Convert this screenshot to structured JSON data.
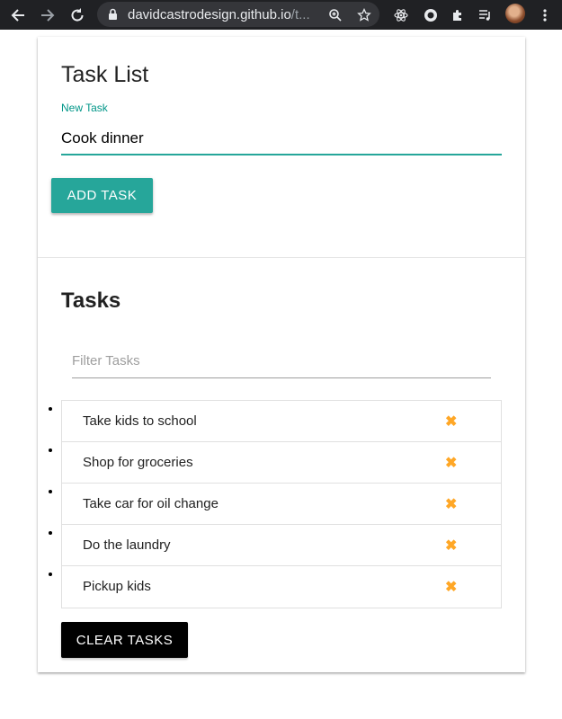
{
  "browser": {
    "url_host": "davidcastrodesign.github.io",
    "url_rest": "/t...",
    "icons": [
      "back-icon",
      "forward-icon",
      "reload-icon",
      "lock-icon",
      "zoom-icon",
      "star-icon",
      "react-devtools-icon",
      "extension-circle-icon",
      "puzzle-icon",
      "media-queue-icon",
      "avatar",
      "menu-icon"
    ]
  },
  "form": {
    "title": "Task List",
    "field_label": "New Task",
    "task_value": "Cook dinner",
    "add_label": "Add Task"
  },
  "tasks": {
    "title": "Tasks",
    "filter_placeholder": "Filter Tasks",
    "items": [
      {
        "text": "Take kids to school"
      },
      {
        "text": "Shop for groceries"
      },
      {
        "text": "Take car for oil change"
      },
      {
        "text": "Do the laundry"
      },
      {
        "text": "Pickup kids"
      }
    ],
    "delete_glyph": "✖",
    "clear_label": "Clear Tasks"
  },
  "colors": {
    "accent": "#26a69a",
    "delete": "#ffa726",
    "chrome": "#202124"
  }
}
